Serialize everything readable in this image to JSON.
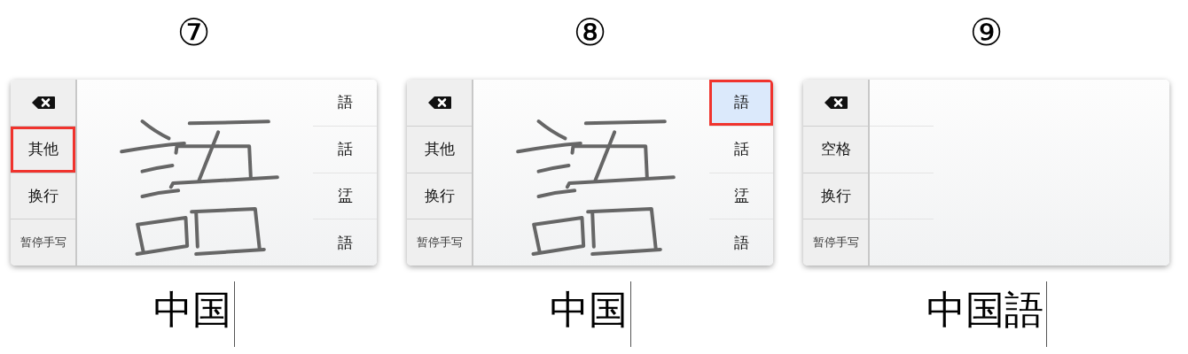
{
  "steps": [
    {
      "label": "⑦",
      "handwriting": true,
      "keys": [
        {
          "kind": "delete",
          "highlighted": false
        },
        {
          "kind": "text",
          "label": "其他",
          "highlighted": true
        },
        {
          "kind": "text",
          "label": "换行",
          "highlighted": false
        },
        {
          "kind": "text",
          "label": "暂停手写",
          "highlighted": false
        }
      ],
      "candidates": [
        {
          "label": "語",
          "highlighted": false,
          "pressed": false
        },
        {
          "label": "話",
          "highlighted": false,
          "pressed": false
        },
        {
          "label": "盓",
          "highlighted": false,
          "pressed": false
        },
        {
          "label": "語",
          "highlighted": false,
          "pressed": false
        }
      ],
      "text": "中国"
    },
    {
      "label": "⑧",
      "handwriting": true,
      "keys": [
        {
          "kind": "delete",
          "highlighted": false
        },
        {
          "kind": "text",
          "label": "其他",
          "highlighted": false
        },
        {
          "kind": "text",
          "label": "换行",
          "highlighted": false
        },
        {
          "kind": "text",
          "label": "暂停手写",
          "highlighted": false
        }
      ],
      "candidates": [
        {
          "label": "語",
          "highlighted": true,
          "pressed": true
        },
        {
          "label": "話",
          "highlighted": false,
          "pressed": false
        },
        {
          "label": "盓",
          "highlighted": false,
          "pressed": false
        },
        {
          "label": "語",
          "highlighted": false,
          "pressed": false
        }
      ],
      "text": "中国"
    },
    {
      "label": "⑨",
      "handwriting": false,
      "keys": [
        {
          "kind": "delete",
          "highlighted": false
        },
        {
          "kind": "text",
          "label": "空格",
          "highlighted": false
        },
        {
          "kind": "text",
          "label": "换行",
          "highlighted": false
        },
        {
          "kind": "text",
          "label": "暂停手写",
          "highlighted": false
        }
      ],
      "text": "中国語"
    }
  ]
}
